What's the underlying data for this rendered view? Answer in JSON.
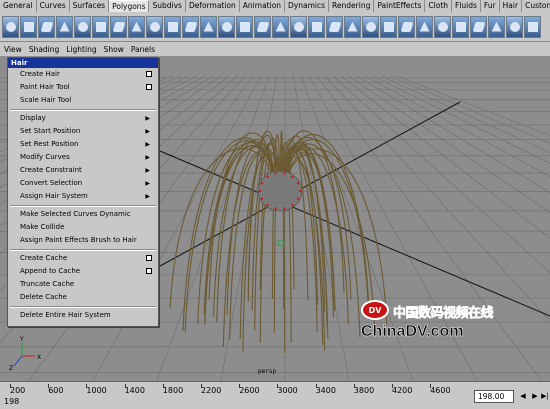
{
  "shelf_tabs": [
    "General",
    "Curves",
    "Surfaces",
    "Polygons",
    "Subdivs",
    "Deformation",
    "Animation",
    "Dynamics",
    "Rendering",
    "PaintEffects",
    "Cloth",
    "Fluids",
    "Fur",
    "Hair",
    "Custom"
  ],
  "shelf_active_tab": "Polygons",
  "shelf_icon_names": [
    "sphere-icon",
    "cube-icon",
    "cylinder-icon",
    "cone-icon",
    "plane-icon",
    "torus-icon",
    "polygon-tool-icon",
    "append-icon",
    "split-icon",
    "extrude-face-icon",
    "extrude-edge-icon",
    "bridge-icon",
    "merge-icon",
    "cut-faces-icon",
    "bevel-icon",
    "smooth-icon",
    "combine-icon",
    "separate-icon",
    "boolean-icon",
    "mirror-icon",
    "triangulate-icon",
    "quadrangulate-icon",
    "reduce-icon",
    "cleanup-icon",
    "sculpt-icon",
    "uv-icon",
    "planar-map-icon",
    "cylindrical-map-icon",
    "spherical-map-icon",
    "auto-map-icon"
  ],
  "panel_menu": [
    "View",
    "Shading",
    "Lighting",
    "Show",
    "Panels"
  ],
  "hair_menu": {
    "title": "Hair",
    "items": [
      {
        "label": "Create Hair",
        "option_box": true
      },
      {
        "label": "Paint Hair Tool",
        "option_box": true
      },
      {
        "label": "Scale Hair Tool"
      },
      {
        "sep": true
      },
      {
        "label": "Display",
        "submenu": true
      },
      {
        "label": "Set Start Position",
        "submenu": true
      },
      {
        "label": "Set Rest Position",
        "submenu": true
      },
      {
        "label": "Modify Curves",
        "submenu": true
      },
      {
        "label": "Create Constraint",
        "submenu": true
      },
      {
        "label": "Convert Selection",
        "submenu": true
      },
      {
        "label": "Assign Hair System",
        "submenu": true
      },
      {
        "sep": true
      },
      {
        "label": "Make Selected Curves Dynamic"
      },
      {
        "label": "Make Collide"
      },
      {
        "label": "Assign Paint Effects Brush to Hair"
      },
      {
        "sep": true
      },
      {
        "label": "Create Cache",
        "option_box": true
      },
      {
        "label": "Append to Cache",
        "option_box": true
      },
      {
        "label": "Truncate Cache"
      },
      {
        "label": "Delete Cache"
      },
      {
        "sep": true
      },
      {
        "label": "Delete Entire Hair System"
      }
    ]
  },
  "viewport": {
    "camera_label": "persp",
    "background_color": "#8d8d8d",
    "hair_color": "#6b5a32",
    "axis_labels": [
      "Y",
      "X",
      "Z"
    ]
  },
  "watermark": {
    "logo_text": "DV",
    "chinese_text": "中国数码视频在线",
    "url_text": "ChinaDV.com"
  },
  "timeline": {
    "ticks": [
      "200",
      "600",
      "1000",
      "1400",
      "1800",
      "2200",
      "2600",
      "3000",
      "3400",
      "3800",
      "4200",
      "4600"
    ],
    "start_frame": "198",
    "current_frame_value": "198.00"
  }
}
